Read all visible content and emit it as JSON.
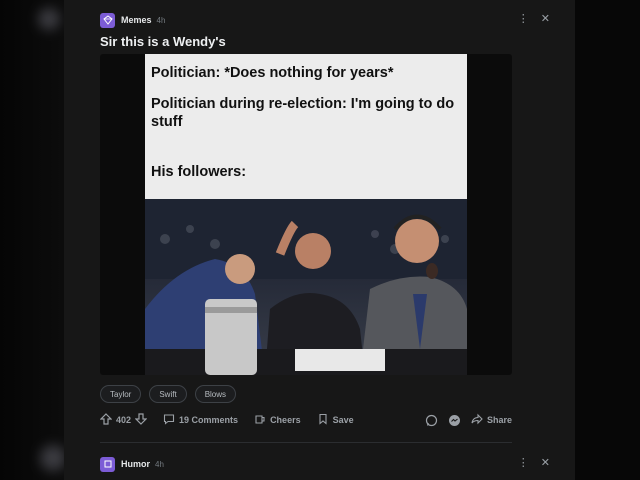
{
  "posts": [
    {
      "subreddit": "Memes",
      "age": "4h",
      "title": "Sir this is a Wendy's",
      "meme_text": [
        "Politician: *Does nothing for years*",
        "Politician during re-election: I'm going to do stuff",
        "His followers:"
      ],
      "tags": [
        "Taylor",
        "Swift",
        "Blows"
      ],
      "upvotes": "402",
      "comments_label": "19 Comments",
      "cheers_label": "Cheers",
      "save_label": "Save",
      "share_label": "Share"
    },
    {
      "subreddit": "Humor",
      "age": "4h"
    }
  ],
  "icons": {
    "more": "more-options-icon",
    "close": "close-icon",
    "upvote": "upvote-icon",
    "downvote": "downvote-icon",
    "comment": "comment-icon",
    "cheers": "cheers-icon",
    "save": "bookmark-icon",
    "whatsapp": "whatsapp-icon",
    "messenger": "messenger-icon",
    "share": "share-icon"
  },
  "colors": {
    "accent": "#7c5cd6",
    "background": "#171717",
    "text": "#d7d9dc"
  }
}
